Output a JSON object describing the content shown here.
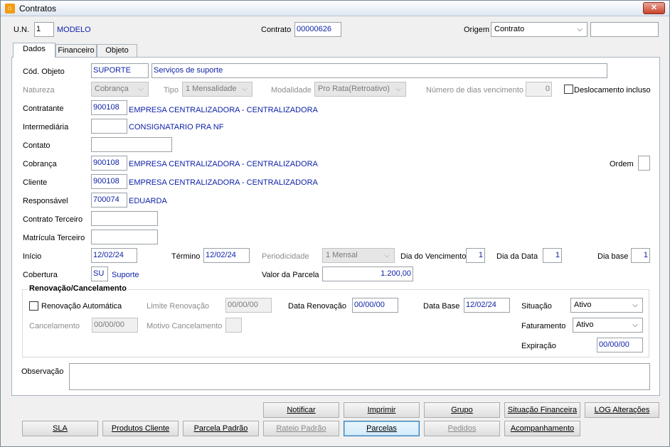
{
  "window": {
    "title": "Contratos",
    "close_label": "✕"
  },
  "header": {
    "un_label": "U.N.",
    "un_value": "1",
    "un_name": "MODELO",
    "contrato_label": "Contrato",
    "contrato_value": "00000626",
    "origem_label": "Origem",
    "origem_value": "Contrato",
    "origem_extra": ""
  },
  "tabs": [
    "Dados",
    "Financeiro",
    "Objeto"
  ],
  "dados": {
    "cod_objeto_label": "Cód. Objeto",
    "cod_objeto_value": "SUPORTE",
    "cod_objeto_desc": "Serviços de suporte",
    "natureza_label": "Natureza",
    "natureza_value": "Cobrança",
    "tipo_label": "Tipo",
    "tipo_value": "1 Mensalidade",
    "modalidade_label": "Modalidade",
    "modalidade_value": "Pro Rata(Retroativo)",
    "dias_venc_label": "Número de dias vencimento",
    "dias_venc_value": "0",
    "deslocamento_label": "Deslocamento incluso",
    "contratante_label": "Contratante",
    "contratante_code": "900108",
    "contratante_name": "EMPRESA CENTRALIZADORA - CENTRALIZADORA",
    "intermediaria_label": "Intermediária",
    "intermediaria_code": "",
    "intermediaria_name": "CONSIGNATARIO PRA NF",
    "contato_label": "Contato",
    "contato_value": "",
    "cobranca_label": "Cobrança",
    "cobranca_code": "900108",
    "cobranca_name": "EMPRESA CENTRALIZADORA - CENTRALIZADORA",
    "ordem_label": "Ordem",
    "ordem_value": "",
    "cliente_label": "Cliente",
    "cliente_code": "900108",
    "cliente_name": "EMPRESA CENTRALIZADORA - CENTRALIZADORA",
    "responsavel_label": "Responsável",
    "responsavel_code": "700074",
    "responsavel_name": "EDUARDA",
    "contrato_terceiro_label": "Contrato Terceiro",
    "contrato_terceiro_value": "",
    "matricula_terceiro_label": "Matrícula Terceiro",
    "matricula_terceiro_value": "",
    "inicio_label": "Início",
    "inicio_value": "12/02/24",
    "termino_label": "Término",
    "termino_value": "12/02/24",
    "periodicidade_label": "Periodicidade",
    "periodicidade_value": "1 Mensal",
    "dia_venc_label": "Dia do Vencimento",
    "dia_venc_value": "1",
    "dia_data_label": "Dia da Data",
    "dia_data_value": "1",
    "dia_base_label": "Dia base",
    "dia_base_value": "1",
    "cobertura_label": "Cobertura",
    "cobertura_code": "SU",
    "cobertura_name": "Suporte",
    "valor_parcela_label": "Valor da Parcela",
    "valor_parcela_value": "1.200,00",
    "renov_group_title": "Renovação/Cancelamento",
    "renov_auto_label": "Renovação Automática",
    "limite_renov_label": "Limite Renovação",
    "limite_renov_value": "00/00/00",
    "data_renov_label": "Data Renovação",
    "data_renov_value": "00/00/00",
    "data_base_label": "Data Base",
    "data_base_value": "12/02/24",
    "situacao_label": "Situação",
    "situacao_value": "Ativo",
    "cancelamento_label": "Cancelamento",
    "cancelamento_value": "00/00/00",
    "motivo_cancel_label": "Motivo Cancelamento",
    "motivo_cancel_value": "",
    "faturamento_label": "Faturamento",
    "faturamento_value": "Ativo",
    "expiracao_label": "Expiração",
    "expiracao_value": "00/00/00",
    "observacao_label": "Observação",
    "observacao_value": ""
  },
  "buttons": {
    "notificar": "Notificar",
    "imprimir": "Imprimir",
    "grupo": "Grupo",
    "situacao_financeira": "Situação Financeira",
    "log_alteracoes": "LOG Alterações",
    "sla": "SLA",
    "produtos_cliente": "Produtos Cliente",
    "parcela_padrao": "Parcela Padrão",
    "rateio_padrao": "Rateio Padrão",
    "parcelas": "Parcelas",
    "pedidos": "Pedidos",
    "acompanhamento": "Acompanhamento"
  }
}
